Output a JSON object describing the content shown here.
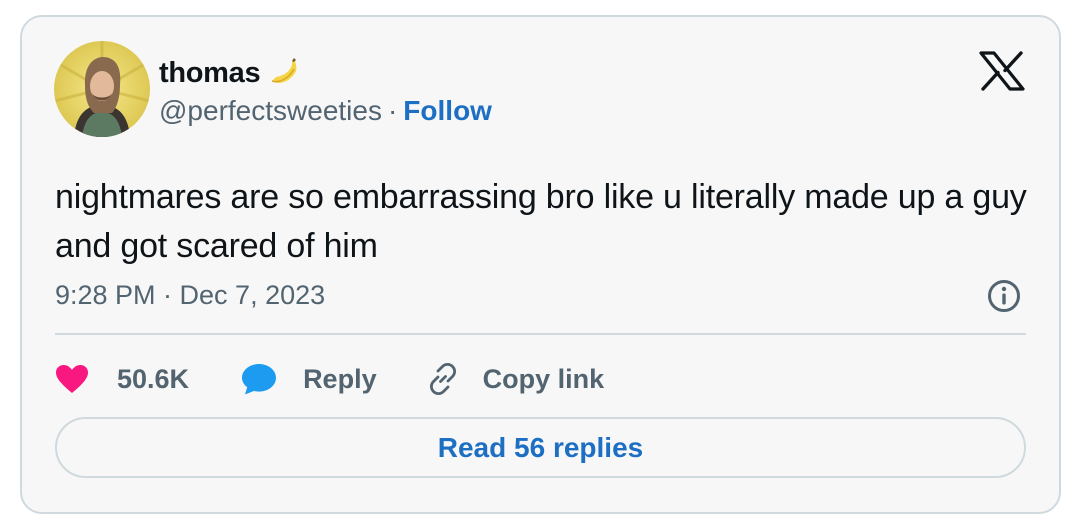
{
  "author": {
    "name": "thomas",
    "name_emoji_icon": "banana-icon",
    "handle": "@perfectsweeties",
    "separator": "·",
    "follow_label": "Follow"
  },
  "tweet": {
    "text": "nightmares are so embarrassing bro like u literally made up a guy and got scared of him",
    "timestamp": "9:28 PM · Dec 7, 2023"
  },
  "actions": {
    "like_count": "50.6K",
    "reply_label": "Reply",
    "copy_link_label": "Copy link"
  },
  "read_replies_label": "Read 56 replies",
  "colors": {
    "card_background": "#f7f7f7",
    "border": "#cfd9de",
    "text_primary": "#0f1419",
    "text_secondary": "#536471",
    "link_blue": "#1d6fc4",
    "like_pink": "#f91880",
    "reply_blue": "#1d9bf0",
    "avatar_background": "#ecd463"
  },
  "icons": [
    "x-logo-icon",
    "info-icon",
    "heart-icon",
    "speech-bubble-icon",
    "link-icon",
    "banana-icon"
  ]
}
